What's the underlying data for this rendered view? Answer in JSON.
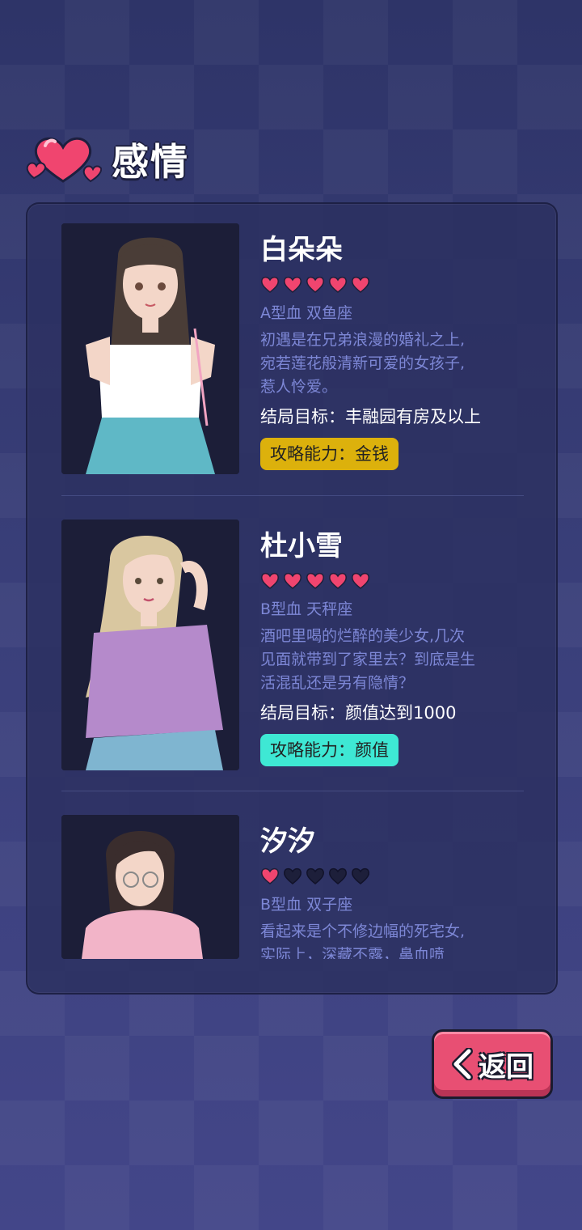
{
  "header": {
    "title": "感情"
  },
  "colors": {
    "heart_full": "#f0456f",
    "heart_empty": "#1d1f3a",
    "gold": "#dcb10c",
    "cyan": "#3ee8d4",
    "back": "#e84f73"
  },
  "characters": [
    {
      "name": "白朵朵",
      "rating": 5,
      "rating_max": 5,
      "blood_zodiac": "A型血  双鱼座",
      "desc": "初遇是在兄弟浪漫的婚礼之上,\n宛若莲花般清新可爱的女孩子,\n惹人怜爱。",
      "goal": "结局目标：丰融园有房及以上",
      "ability": "攻略能力：金钱",
      "ability_color": "#dcb10c"
    },
    {
      "name": "杜小雪",
      "rating": 5,
      "rating_max": 5,
      "blood_zodiac": "B型血  天秤座",
      "desc": "酒吧里喝的烂醉的美少女,几次\n见面就带到了家里去？到底是生\n活混乱还是另有隐情？",
      "goal": "结局目标：颜值达到1000",
      "ability": "攻略能力：颜值",
      "ability_color": "#3ee8d4"
    },
    {
      "name": "汐汐",
      "rating": 1,
      "rating_max": 5,
      "blood_zodiac": "B型血  双子座",
      "desc": "看起来是个不修边幅的死宅女,\n实际上，深藏不露，鼻血喷",
      "goal": "",
      "ability": "",
      "ability_color": ""
    }
  ],
  "back_button": {
    "label": "返回"
  }
}
